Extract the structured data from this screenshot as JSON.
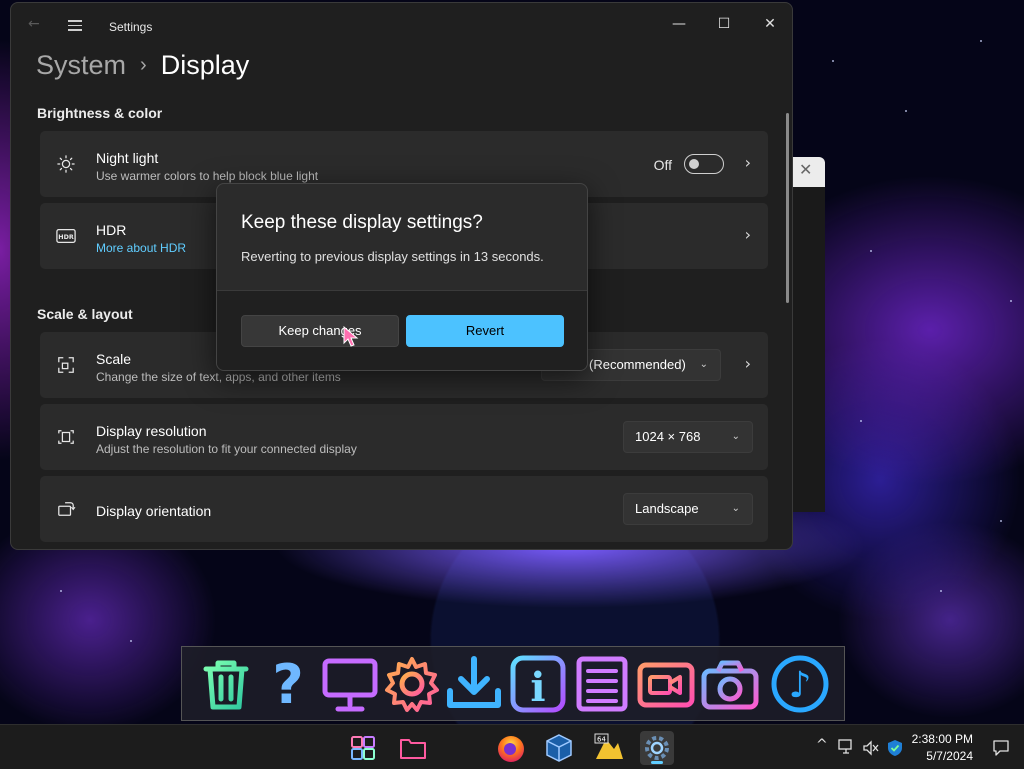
{
  "window": {
    "title": "Settings",
    "back_glyph": "←",
    "minimize_glyph": "—",
    "maximize_glyph": "☐",
    "close_glyph": "✕"
  },
  "breadcrumb": {
    "parent": "System",
    "separator": "›",
    "current": "Display"
  },
  "sections": {
    "brightness": "Brightness & color",
    "scale_layout": "Scale & layout"
  },
  "night_light": {
    "title": "Night light",
    "subtitle": "Use warmer colors to help block blue light",
    "toggle_label": "Off",
    "toggle_on": false,
    "icon": "brightness-icon"
  },
  "hdr": {
    "title": "HDR",
    "link": "More about HDR",
    "icon": "hdr-icon"
  },
  "scale": {
    "title": "Scale",
    "subtitle": "Change the size of text, apps, and other items",
    "value": "(Recommended)",
    "icon": "scale-icon"
  },
  "resolution": {
    "title": "Display resolution",
    "subtitle": "Adjust the resolution to fit your connected display",
    "value": "1024 × 768",
    "icon": "resolution-icon"
  },
  "orientation": {
    "title": "Display orientation",
    "value": "Landscape",
    "icon": "orientation-icon"
  },
  "dialog": {
    "title": "Keep these display settings?",
    "message": "Reverting to previous display settings in 13 seconds.",
    "keep_label": "Keep changes",
    "revert_label": "Revert"
  },
  "dock": {
    "icons": [
      "trash-icon",
      "help-icon",
      "monitor-icon",
      "settings-gear-icon",
      "download-icon",
      "info-icon",
      "document-icon",
      "video-camera-icon",
      "photo-camera-icon",
      "music-icon"
    ],
    "help_glyph": "?",
    "info_glyph": "i",
    "music_glyph": "♪"
  },
  "taskbar": {
    "apps": [
      "start-icon",
      "file-explorer-icon",
      "firefox-icon",
      "virtualbox-icon",
      "app-64-icon",
      "settings-icon"
    ],
    "app64_badge": "64",
    "tray_chevron": "^",
    "time": "2:38:00 PM",
    "date": "5/7/2024"
  },
  "colors": {
    "accent": "#4cc2ff",
    "link": "#60cdff",
    "window_bg": "#1f1f1f",
    "card_bg": "#2b2b2b"
  }
}
